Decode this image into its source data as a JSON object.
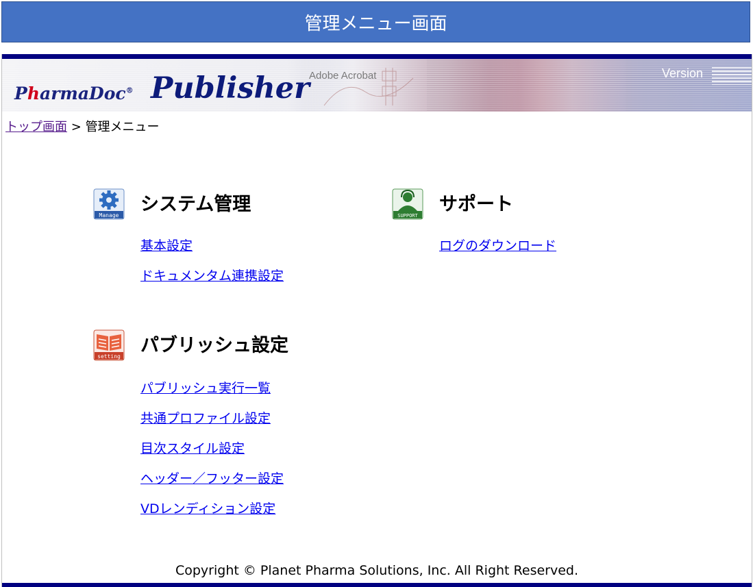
{
  "window": {
    "title": "管理メニュー画面"
  },
  "banner": {
    "logo_pharma_1": "P",
    "logo_pharma_2": "h",
    "logo_pharma_3": "armaDoc",
    "logo_pharma_reg": "®",
    "logo_publisher": "Publisher",
    "acrobat_text": "Adobe Acrobat",
    "version_label": "Version"
  },
  "breadcrumb": {
    "home_link": "トップ画面",
    "separator": ">",
    "current": "管理メニュー"
  },
  "sections": {
    "system": {
      "icon": "gear-manage-icon",
      "icon_label": "Manage",
      "title": "システム管理",
      "links": [
        "基本設定",
        "ドキュメンタム連携設定"
      ]
    },
    "support": {
      "icon": "support-person-icon",
      "icon_label": "SUPPORT",
      "title": "サポート",
      "links": [
        "ログのダウンロード"
      ]
    },
    "publish": {
      "icon": "book-setting-icon",
      "icon_label": "setting",
      "title": "パブリッシュ設定",
      "links": [
        "パブリッシュ実行一覧",
        "共通プロファイル設定",
        "目次スタイル設定",
        "ヘッダー／フッター設定",
        "VDレンディション設定"
      ]
    }
  },
  "footer": {
    "copyright": "Copyright © Planet Pharma Solutions, Inc. All Right Reserved."
  },
  "colors": {
    "title_bar": "#4472c4",
    "frame_border": "#000080",
    "link": "#0000ee",
    "visited_link": "#551a8b"
  }
}
